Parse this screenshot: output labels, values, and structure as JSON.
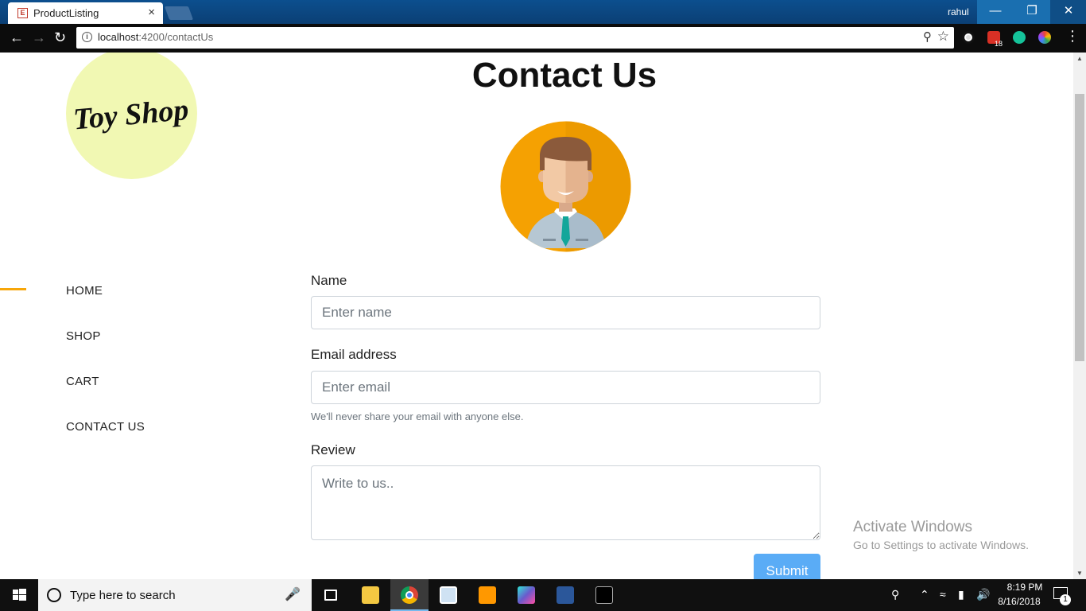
{
  "browser": {
    "tab_title": "ProductListing",
    "tab_favicon_letter": "E",
    "tab_close": "×",
    "profile_name": "rahul",
    "window_buttons": {
      "minimize": "—",
      "restore": "❐",
      "close": "✕"
    },
    "url_host": "localhost",
    "url_path": ":4200/contactUs",
    "extension_badge": "18"
  },
  "logo": {
    "text": "Toy Shop"
  },
  "page": {
    "title": "Contact Us"
  },
  "nav": {
    "items": [
      {
        "label": "HOME"
      },
      {
        "label": "SHOP"
      },
      {
        "label": "CART"
      },
      {
        "label": "CONTACT US"
      }
    ]
  },
  "form": {
    "name_label": "Name",
    "name_placeholder": "Enter name",
    "email_label": "Email address",
    "email_placeholder": "Enter email",
    "email_help": "We'll never share your email with anyone else.",
    "review_label": "Review",
    "review_placeholder": "Write to us..",
    "submit_label": "Submit"
  },
  "watermark": {
    "title": "Activate Windows",
    "subtitle": "Go to Settings to activate Windows."
  },
  "taskbar": {
    "search_placeholder": "Type here to search",
    "time": "8:19 PM",
    "date": "8/16/2018",
    "notification_count": "1"
  },
  "colors": {
    "logo_bg": "#f1f8b3",
    "avatar_bg": "#f5a102",
    "accent": "#f7a609",
    "submit_bg": "#5aacf6"
  }
}
